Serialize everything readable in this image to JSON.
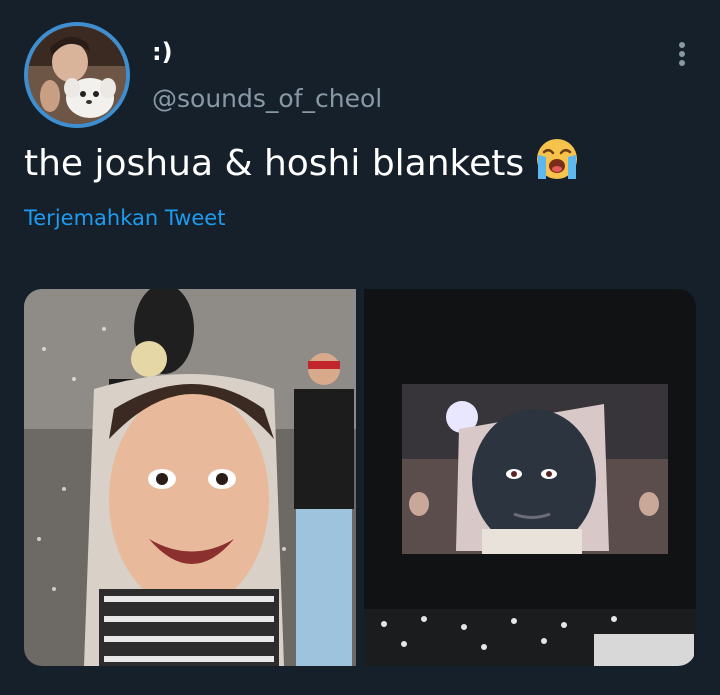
{
  "user": {
    "display_name": ":)",
    "handle": "@sounds_of_cheol",
    "avatar_icon": "profile-photo-with-dog"
  },
  "tweet": {
    "text": "the joshua & hoshi blankets",
    "emoji": "loudly-crying-face-emoji"
  },
  "translate_label": "Terjemahkan Tweet",
  "media": [
    {
      "id": "photo-1",
      "description_icon": "concert-photo-blanket-left"
    },
    {
      "id": "photo-2",
      "description_icon": "concert-photo-blanket-right"
    }
  ],
  "colors": {
    "background": "#15202b",
    "link": "#1d9bf0",
    "secondary_text": "#8899a6",
    "avatar_ring": "#3e8ed0"
  }
}
